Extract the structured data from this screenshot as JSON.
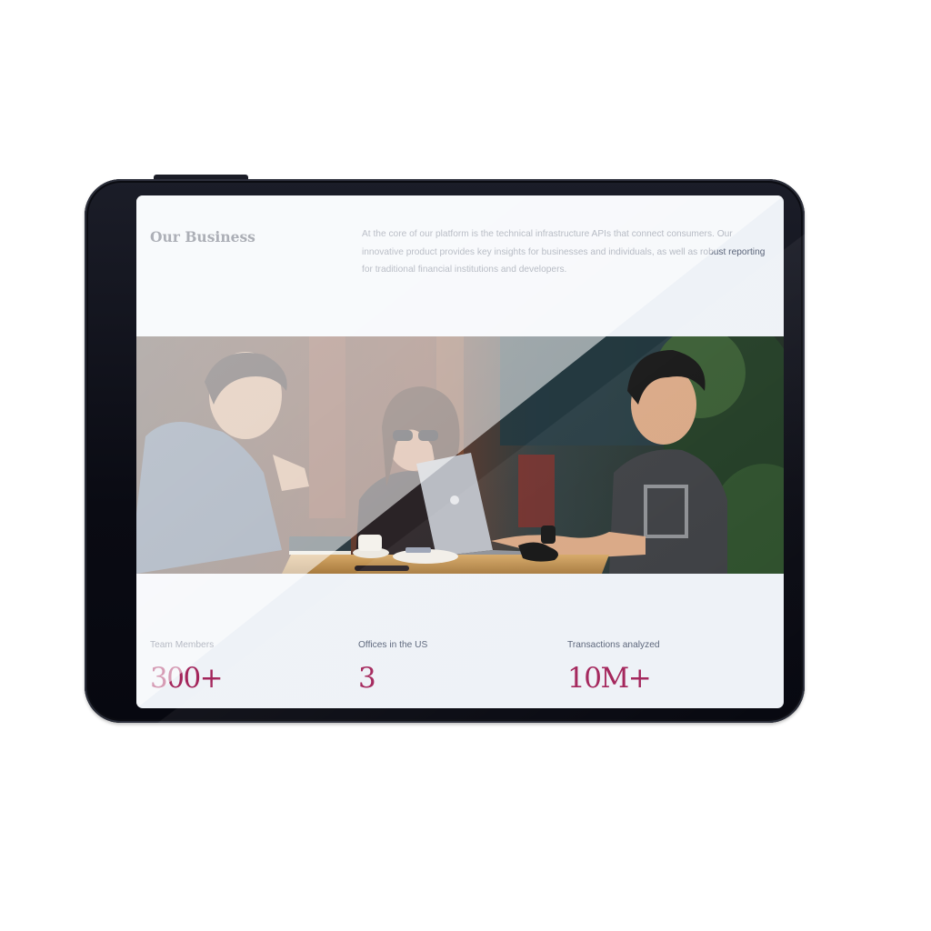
{
  "business": {
    "title": "Our Business",
    "description": "At the core of our platform is the technical infrastructure APIs that connect consumers. Our innovative product provides key insights for businesses and individuals, as well as robust reporting for traditional financial institutions and developers."
  },
  "photo": {
    "alt": "Three people working together at a café table with a laptop"
  },
  "stats": [
    {
      "label": "Team Members",
      "value": "300+"
    },
    {
      "label": "Offices in the US",
      "value": "3"
    },
    {
      "label": "Transactions analyzed",
      "value": "10M+"
    }
  ],
  "colors": {
    "accent": "#a3245a",
    "text": "#5a6479",
    "heading": "#2c3346",
    "screen_bg": "#eef2f7",
    "device": "#0a0b13"
  }
}
